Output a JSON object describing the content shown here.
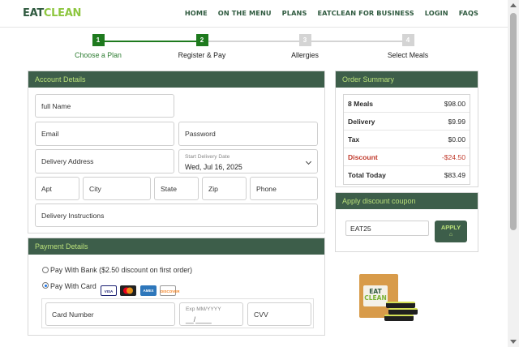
{
  "brand": {
    "logo_eat": "EAT",
    "logo_clean": "CLEAN"
  },
  "nav": {
    "items": [
      "HOME",
      "ON THE MENU",
      "PLANS",
      "EATCLEAN FOR BUSINESS",
      "LOGIN",
      "FAQS"
    ]
  },
  "stepper": {
    "steps": [
      {
        "number": "1",
        "label": "Choose a Plan",
        "state": "complete"
      },
      {
        "number": "2",
        "label": "Register & Pay",
        "state": "active"
      },
      {
        "number": "3",
        "label": "Allergies",
        "state": "pending"
      },
      {
        "number": "4",
        "label": "Select Meals",
        "state": "pending"
      }
    ]
  },
  "account": {
    "title": "Account Details",
    "full_name_placeholder": "full Name",
    "email_placeholder": "Email",
    "password_placeholder": "Password",
    "address_placeholder": "Delivery Address",
    "start_date_label": "Start Delivery Date",
    "start_date_value": "Wed, Jul 16, 2025",
    "apt_placeholder": "Apt",
    "city_placeholder": "City",
    "state_placeholder": "State",
    "zip_placeholder": "Zip",
    "phone_placeholder": "Phone",
    "instructions_placeholder": "Delivery Instructions"
  },
  "payment": {
    "title": "Payment Details",
    "option_bank": "Pay With Bank ($2.50 discount on first order)",
    "option_card": "Pay With Card",
    "selected": "card",
    "card_logos": [
      "VISA",
      "MC",
      "AMEX",
      "DISCOVER"
    ],
    "card_number_placeholder": "Card Number",
    "exp_label": "Exp MM/YYYY",
    "exp_mask": "__/____",
    "cvv_placeholder": "CVV"
  },
  "summary": {
    "title": "Order Summary",
    "rows": [
      {
        "label": "8 Meals",
        "value": "$98.00"
      },
      {
        "label": "Delivery",
        "value": "$9.99"
      },
      {
        "label": "Tax",
        "value": "$0.00"
      },
      {
        "label": "Discount",
        "value": "-$24.50"
      },
      {
        "label": "Total Today",
        "value": "$83.49"
      }
    ]
  },
  "coupon": {
    "title": "Apply discount coupon",
    "code": "EAT25",
    "apply_label": "APPLY"
  },
  "product": {
    "bag_eat": "EAT",
    "bag_clean": "CLEAN"
  },
  "colors": {
    "brand_dark": "#3d5e4a",
    "brand_green": "#8dc63f",
    "step_complete": "#1e7a1e",
    "discount_red": "#c0392b"
  }
}
